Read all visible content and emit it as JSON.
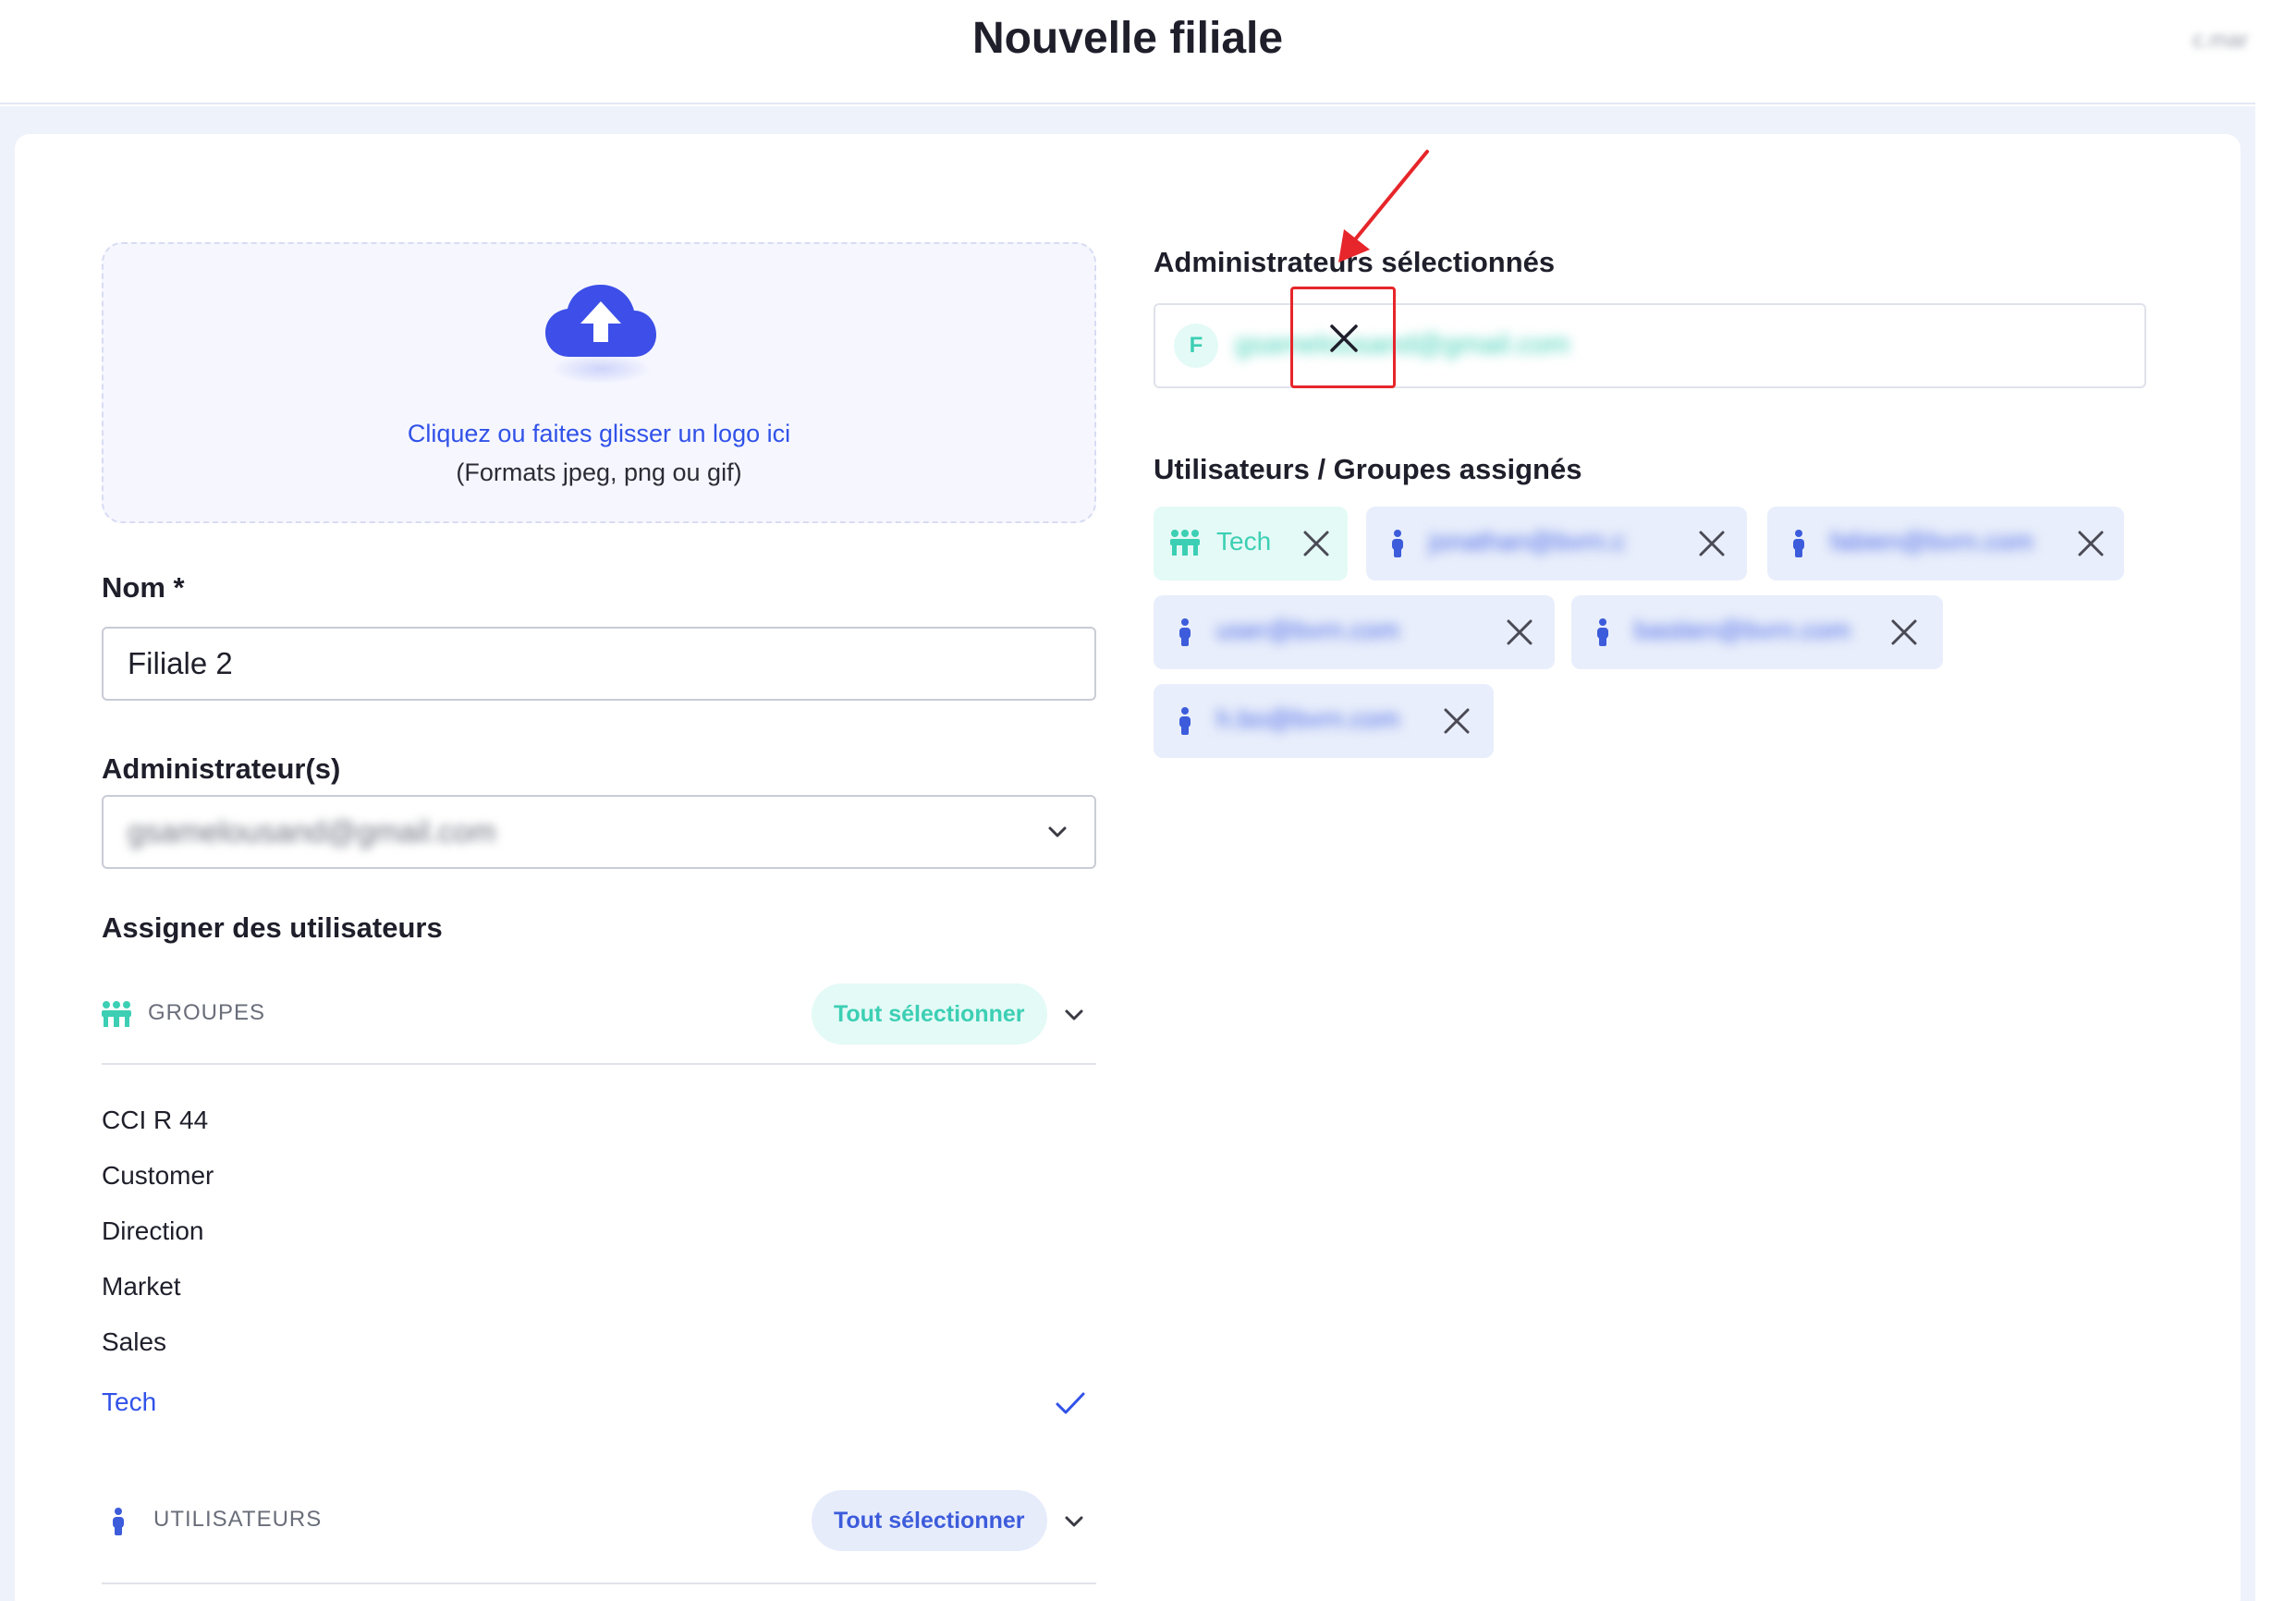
{
  "header": {
    "title": "Nouvelle filiale",
    "user": "c.mar"
  },
  "upload": {
    "main_text": "Cliquez ou faites glisser un logo ici",
    "sub_text": "(Formats jpeg, png ou gif)"
  },
  "form": {
    "name_label": "Nom *",
    "name_value": "Filiale 2",
    "admins_label": "Administrateur(s)",
    "admins_value": "gsamelousand@gmail.com",
    "assign_label": "Assigner des utilisateurs"
  },
  "groups_section": {
    "label": "GROUPES",
    "select_all": "Tout sélectionner",
    "items": [
      "CCI R 44",
      "Customer",
      "Direction",
      "Market",
      "Sales",
      "Tech"
    ],
    "selected": "Tech"
  },
  "users_section": {
    "label": "UTILISATEURS",
    "select_all": "Tout sélectionner"
  },
  "selected_admins": {
    "label": "Administrateurs sélectionnés",
    "avatar_initial": "F",
    "email": "gsamelousand@gmail.com"
  },
  "assigned": {
    "label": "Utilisateurs / Groupes assignés",
    "chips": [
      {
        "type": "group",
        "text": "Tech"
      },
      {
        "type": "user",
        "text": "jonathan@bvrn.c"
      },
      {
        "type": "user",
        "text": "fabien@bvrn.com"
      },
      {
        "type": "user",
        "text": "user@bvrn.com"
      },
      {
        "type": "user",
        "text": "bastien@bvrn.com"
      },
      {
        "type": "user",
        "text": "h.bo@bvrn.com"
      }
    ]
  },
  "colors": {
    "accent_blue": "#3152e8",
    "accent_teal": "#3ccfb4",
    "highlight_red": "#e6262a"
  }
}
